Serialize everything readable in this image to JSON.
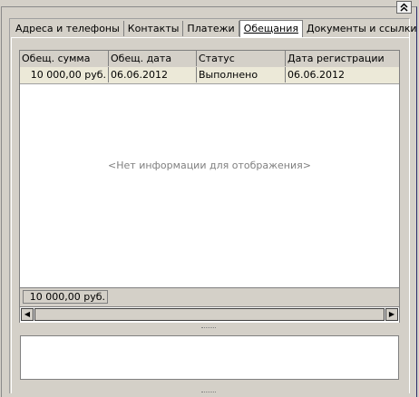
{
  "collapse_button": {
    "glyph": "«"
  },
  "tabs": [
    {
      "label": "Адреса и телефоны"
    },
    {
      "label": "Контакты"
    },
    {
      "label": "Платежи"
    },
    {
      "label": "Обещания",
      "active": true
    },
    {
      "label": "Документы и ссылки"
    }
  ],
  "grid": {
    "columns": [
      "Обещ. сумма",
      "Обещ. дата",
      "Статус",
      "Дата регистрации"
    ],
    "rows": [
      [
        "10 000,00 руб.",
        "06.06.2012",
        "Выполнено",
        "06.06.2012"
      ]
    ],
    "empty_message": "<Нет информации для отображения>",
    "footer_total": "10 000,00 руб."
  },
  "scrollbar": {
    "left_arrow": "◀",
    "right_arrow": "▶"
  },
  "colors": {
    "background": "#d4d0c8",
    "selected_row": "#ece9d8",
    "frame_border": "#2a2a6a"
  }
}
